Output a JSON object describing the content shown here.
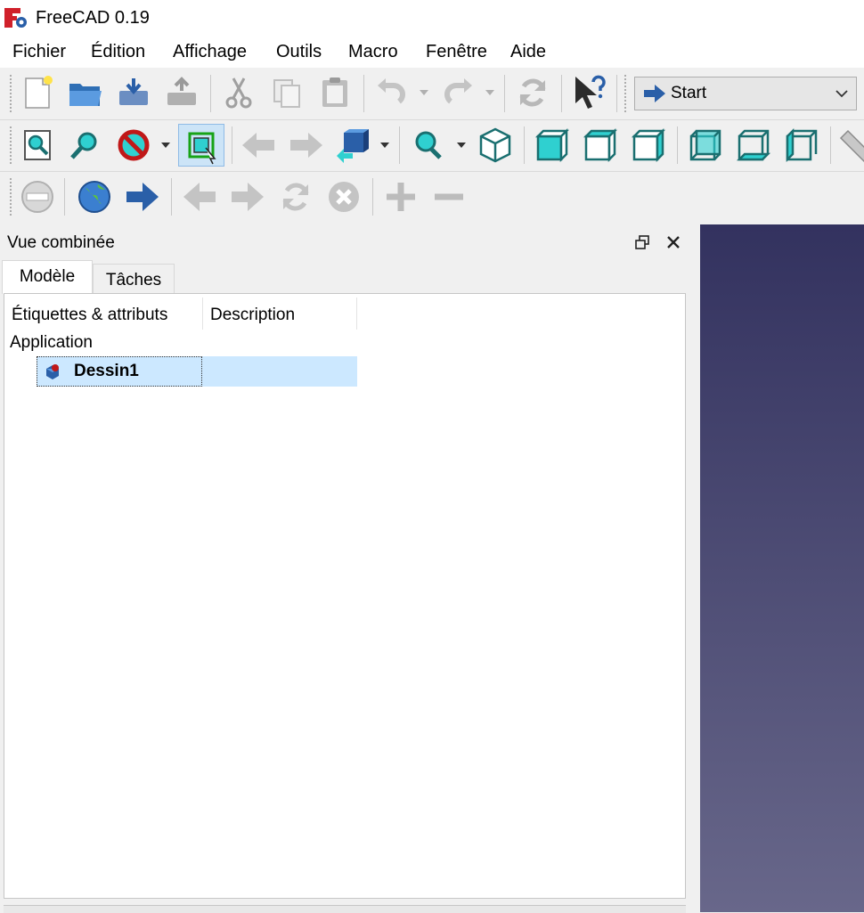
{
  "window": {
    "title": "FreeCAD 0.19"
  },
  "menu": [
    "Fichier",
    "Édition",
    "Affichage",
    "Outils",
    "Macro",
    "Fenêtre",
    "Aide"
  ],
  "workbench": {
    "label": "Start"
  },
  "combo_view": {
    "title": "Vue combinée",
    "tabs": [
      "Modèle",
      "Tâches"
    ],
    "tree": {
      "columns": [
        "Étiquettes & attributs",
        "Description"
      ],
      "root": "Application",
      "document": "Dessin1"
    }
  },
  "colors": {
    "accent_cyan": "#2fd0d0",
    "selection": "#cce8ff",
    "view_top": "#33325f",
    "view_bottom": "#68678a"
  }
}
